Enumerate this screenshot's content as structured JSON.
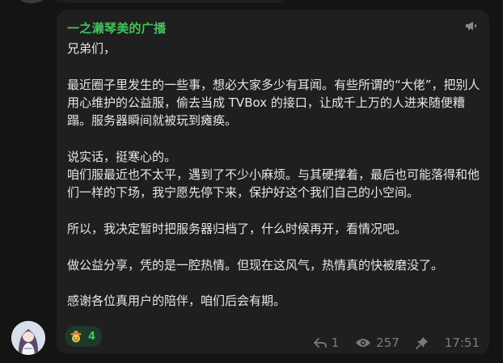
{
  "message": {
    "channel_name": "一之濑琴美的广播",
    "paragraphs": [
      [
        "兄弟们，"
      ],
      [
        "最近圈子里发生的一些事，想必大家多少有耳闻。有些所谓的“大佬”，把别人用心维护的公益服，偷去当成 TVBox 的接口，让成千上万的人进来随便糟蹋。服务器瞬间就被玩到瘫痪。"
      ],
      [
        "说实话，挺寒心的。",
        "咱们服最近也不太平，遇到了不少小麻烦。与其硬撑着，最后也可能落得和他们一样的下场，我宁愿先停下来，保护好这个我们自己的小空间。"
      ],
      [
        "所以，我决定暂时把服务器归档了，什么时候再开，看情况吧。"
      ],
      [
        "做公益分享，凭的是一腔热情。但现在这风气，热情真的快被磨没了。"
      ],
      [
        "感谢各位真用户的陪伴，咱们后会有期。"
      ]
    ],
    "reaction": {
      "emoji": "cowboy-face",
      "count": "4"
    },
    "meta": {
      "replies": "1",
      "views": "257",
      "time": "17:51"
    }
  },
  "colors": {
    "accent": "#3fc35a",
    "bubble": "#1f1f1f",
    "background": "#141414",
    "text": "#e6e6e6",
    "muted": "#7b7b7b"
  }
}
